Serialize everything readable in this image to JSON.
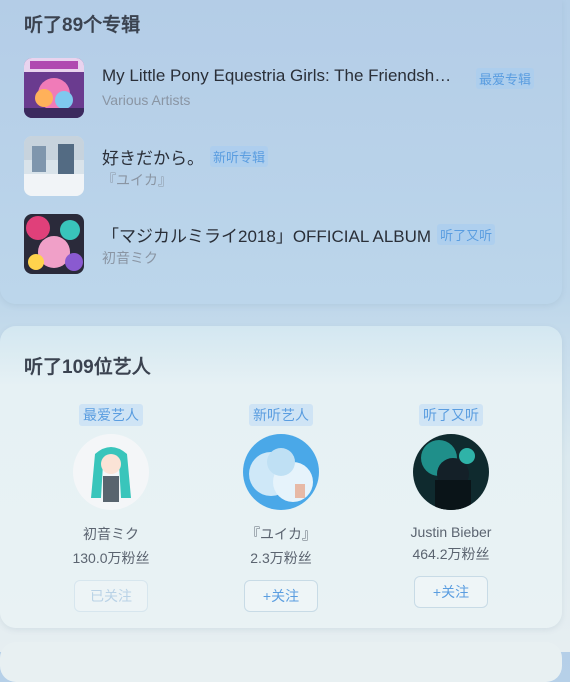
{
  "albums_section": {
    "title": "听了89个专辑",
    "items": [
      {
        "title": "My Little Pony Equestria Girls: The Friendsh…",
        "tag": "最爱专辑",
        "artist": "Various Artists"
      },
      {
        "title": "好きだから。",
        "tag": "新听专辑",
        "artist": "『ユイカ』"
      },
      {
        "title": "「マジカルミライ2018」OFFICIAL ALBUM",
        "tag": "听了又听",
        "artist": "初音ミク"
      }
    ]
  },
  "artists_section": {
    "title": "听了109位艺人",
    "items": [
      {
        "tag": "最爱艺人",
        "name": "初音ミク",
        "fans": "130.0万粉丝",
        "follow_label": "已关注",
        "followed": true
      },
      {
        "tag": "新听艺人",
        "name": "『ユイカ』",
        "fans": "2.3万粉丝",
        "follow_label": "+关注",
        "followed": false
      },
      {
        "tag": "听了又听",
        "name": "Justin Bieber",
        "fans": "464.2万粉丝",
        "follow_label": "+关注",
        "followed": false
      }
    ]
  },
  "colors": {
    "accent": "#5a9de0",
    "tag_bg": "#cfe4f5",
    "text_primary": "#2a2f38",
    "text_secondary": "#8a95a3"
  }
}
